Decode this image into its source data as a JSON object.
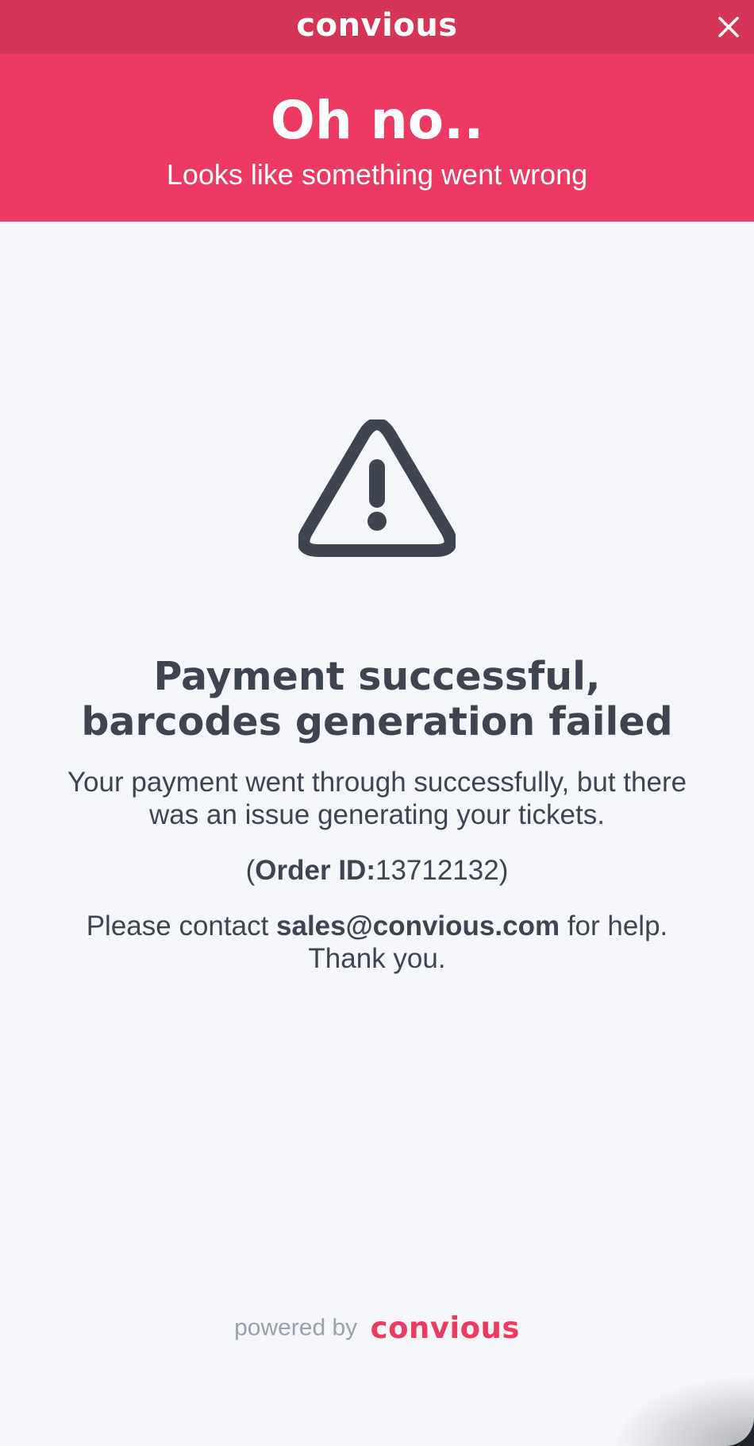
{
  "app": {
    "brand": "convious"
  },
  "topbar": {
    "close_icon": "close-icon"
  },
  "hero": {
    "title": "Oh no..",
    "subtitle": "Looks like something went wrong"
  },
  "content": {
    "icon": "warning-icon",
    "title_line_1": "Payment successful,",
    "title_line_2": "barcodes generation failed",
    "message": "Your payment went through successfully, but there was an issue generating your tickets.",
    "order_prefix": "(",
    "order_label": "Order ID:",
    "order_id": "13712132",
    "order_suffix": ")",
    "contact_prefix": "Please contact",
    "contact_email": "sales@convious.com",
    "contact_suffix": "for help.",
    "thanks": "Thank you."
  },
  "footer": {
    "powered_by": "powered by",
    "brand": "convious"
  },
  "colors": {
    "topbar": "#d43456",
    "hero": "#ec3a62",
    "background": "#f4f6fa",
    "text": "#3e4550",
    "muted": "#9aa1aa"
  }
}
